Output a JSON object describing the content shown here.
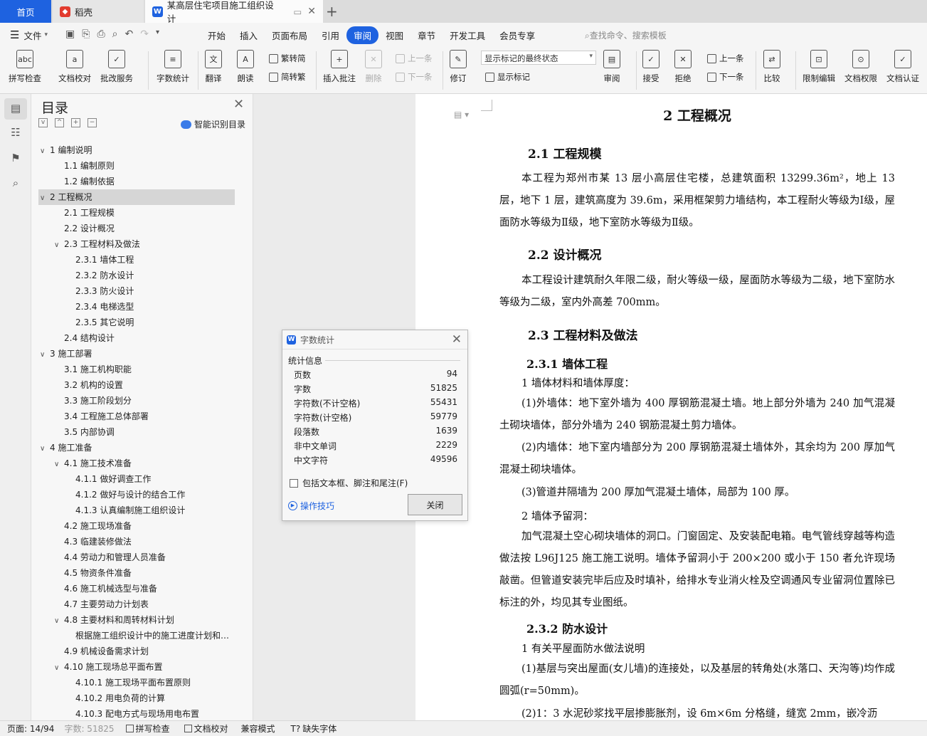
{
  "tabs": {
    "home": "首页",
    "daoke": "稻壳",
    "doc": "某高层住宅项目施工组织设计"
  },
  "menubar": {
    "file": "文件",
    "items": [
      "开始",
      "插入",
      "页面布局",
      "引用",
      "审阅",
      "视图",
      "章节",
      "开发工具",
      "会员专享"
    ],
    "active": "审阅",
    "search": "查找命令、搜索模板"
  },
  "ribbon": {
    "spell": "拼写检查",
    "proof": "文档校对",
    "batch": "批改服务",
    "wordcount": "字数统计",
    "translate": "翻译",
    "read": "朗读",
    "trad": "繁转简",
    "simp": "简转繁",
    "insert_comment": "插入批注",
    "delete": "删除",
    "prev_c": "上一条",
    "next_c": "下一条",
    "revise": "修订",
    "markup_select": "显示标记的最终状态",
    "show_markup": "显示标记",
    "review": "审阅",
    "accept": "接受",
    "reject": "拒绝",
    "prev": "上一条",
    "next": "下一条",
    "compare": "比较",
    "restrict": "限制编辑",
    "perm": "文档权限",
    "cert": "文档认证"
  },
  "toc": {
    "title": "目录",
    "smart": "智能识别目录",
    "items": [
      {
        "t": "1  编制说明",
        "lvl": 0,
        "arrow": "v"
      },
      {
        "t": "1.1  编制原则",
        "lvl": 1
      },
      {
        "t": "1.2  编制依据",
        "lvl": 1
      },
      {
        "t": "2  工程概况",
        "lvl": 0,
        "arrow": "v",
        "sel": true
      },
      {
        "t": "2.1 工程规模",
        "lvl": 1
      },
      {
        "t": "2.2 设计概况",
        "lvl": 1
      },
      {
        "t": "2.3 工程材料及做法",
        "lvl": 1,
        "arrow": "v"
      },
      {
        "t": "2.3.1 墙体工程",
        "lvl": 2
      },
      {
        "t": "2.3.2 防水设计",
        "lvl": 2
      },
      {
        "t": "2.3.3 防火设计",
        "lvl": 2
      },
      {
        "t": "2.3.4 电梯选型",
        "lvl": 2
      },
      {
        "t": "2.3.5 其它说明",
        "lvl": 2
      },
      {
        "t": "2.4 结构设计",
        "lvl": 1
      },
      {
        "t": "3  施工部署",
        "lvl": 0,
        "arrow": "v"
      },
      {
        "t": "3.1 施工机构职能",
        "lvl": 1
      },
      {
        "t": "3.2  机构的设置",
        "lvl": 1
      },
      {
        "t": "3.3  施工阶段划分",
        "lvl": 1
      },
      {
        "t": "3.4 工程施工总体部署",
        "lvl": 1
      },
      {
        "t": "3.5 内部协调",
        "lvl": 1
      },
      {
        "t": "4  施工准备",
        "lvl": 0,
        "arrow": "v"
      },
      {
        "t": "4.1  施工技术准备",
        "lvl": 1,
        "arrow": "v"
      },
      {
        "t": "4.1.1 做好调查工作",
        "lvl": 2
      },
      {
        "t": "4.1.2 做好与设计的结合工作",
        "lvl": 2
      },
      {
        "t": "4.1.3 认真编制施工组织设计",
        "lvl": 2
      },
      {
        "t": "4.2  施工现场准备",
        "lvl": 1
      },
      {
        "t": "4.3  临建装修做法",
        "lvl": 1
      },
      {
        "t": "4.4  劳动力和管理人员准备",
        "lvl": 1
      },
      {
        "t": "4.5 物资条件准备",
        "lvl": 1
      },
      {
        "t": "4.6  施工机械选型与准备",
        "lvl": 1
      },
      {
        "t": "4.7  主要劳动力计划表",
        "lvl": 1
      },
      {
        "t": "4.8  主要材料和周转材料计划",
        "lvl": 1,
        "arrow": "v"
      },
      {
        "t": "根据施工组织设计中的施工进度计划和…",
        "lvl": 2
      },
      {
        "t": "4.9  机械设备需求计划",
        "lvl": 1
      },
      {
        "t": "4.10  施工现场总平面布置",
        "lvl": 1,
        "arrow": "v"
      },
      {
        "t": "4.10.1 施工现场平面布置原则",
        "lvl": 2
      },
      {
        "t": "4.10.2  用电负荷的计算",
        "lvl": 2
      },
      {
        "t": "4.10.3  配电方式与现场用电布置",
        "lvl": 2
      }
    ]
  },
  "doc": {
    "h1": "2  工程概况",
    "h21": "2.1 工程规模",
    "p1": "本工程为郑州市某 13 层小高层住宅楼，总建筑面积 13299.36m²，地上 13 层，地下 1 层，建筑高度为 39.6m，采用框架剪力墙结构，本工程耐火等级为Ⅰ级，屋面防水等级为Ⅱ级，地下室防水等级为Ⅱ级。",
    "h22": "2.2 设计概况",
    "p2": "本工程设计建筑耐久年限二级，耐火等级一级，屋面防水等级为二级，地下室防水等级为二级，室内外高差 700mm。",
    "h23": "2.3 工程材料及做法",
    "h231": "2.3.1 墙体工程",
    "l1": "1 墙体材料和墙体厚度：",
    "p3": "(1)外墙体：地下室外墙为 400 厚钢筋混凝土墙。地上部分外墙为 240 加气混凝土砌块墙体，部分外墙为 240 钢筋混凝土剪力墙体。",
    "p4": "(2)内墙体：地下室内墙部分为 200 厚钢筋混凝土墙体外，其余均为 200 厚加气混凝土砌块墙体。",
    "p5": "(3)管道井隔墙为 200 厚加气混凝土墙体，局部为 100 厚。",
    "l2": "2 墙体予留洞：",
    "p6": "加气混凝土空心砌块墙体的洞口。门窗固定、及安装配电箱。电气管线穿越等构造做法按 L96J125 施工施工说明。墙体予留洞小于 200×200 或小于 150 者允许现场敲凿。但管道安装完毕后应及时填补，给排水专业消火栓及空调通风专业留洞位置除已标注的外，均见其专业图纸。",
    "h232": "2.3.2 防水设计",
    "l3": "1 有关平屋面防水做法说明",
    "p7": "(1)基层与突出屋面(女儿墙)的连接处，以及基层的转角处(水落口、天沟等)均作成圆弧(r=50mm)。",
    "p8": "(2)1：3 水泥砂浆找平层掺膨胀剂，设 6m×6m 分格缝，缝宽 2mm，嵌冷沥"
  },
  "dialog": {
    "title": "字数统计",
    "section": "统计信息",
    "rows": [
      {
        "k": "页数",
        "v": "94"
      },
      {
        "k": "字数",
        "v": "51825"
      },
      {
        "k": "字符数(不计空格)",
        "v": "55431"
      },
      {
        "k": "字符数(计空格)",
        "v": "59779"
      },
      {
        "k": "段落数",
        "v": "1639"
      },
      {
        "k": "非中文单词",
        "v": "2229"
      },
      {
        "k": "中文字符",
        "v": "49596"
      }
    ],
    "checkbox": "包括文本框、脚注和尾注(F)",
    "tip": "操作技巧",
    "close": "关闭"
  },
  "status": {
    "page": "页面: 14/94",
    "words": "字数: 51825",
    "spell": "拼写检查",
    "proof": "文档校对",
    "compat": "兼容模式",
    "font": "缺失字体"
  }
}
